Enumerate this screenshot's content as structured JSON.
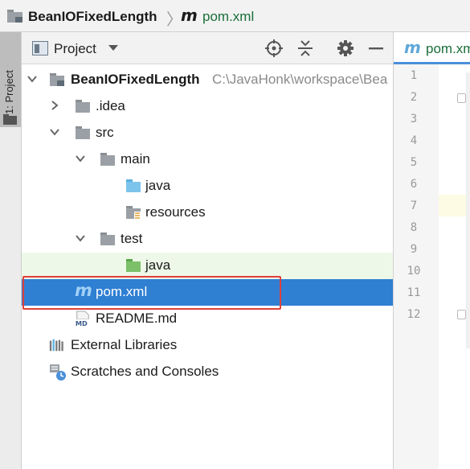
{
  "breadcrumb": {
    "project": "BeanIOFixedLength",
    "file": "pom.xml",
    "maven_glyph": "m"
  },
  "sidebar": {
    "tab_label": "1: Project"
  },
  "panel": {
    "title": "Project"
  },
  "tree": {
    "root": {
      "name": "BeanIOFixedLength",
      "path": "C:\\JavaHonk\\workspace\\Bea"
    },
    "idea": ".idea",
    "src": "src",
    "main": "main",
    "main_java": "java",
    "resources": "resources",
    "test": "test",
    "test_java": "java",
    "pom": "pom.xml",
    "readme": "README.md",
    "readme_badge": "MD",
    "external_libraries": "External Libraries",
    "scratches": "Scratches and Consoles"
  },
  "editor": {
    "tab_label": "pom.xm",
    "line_numbers": [
      "1",
      "2",
      "3",
      "4",
      "5",
      "6",
      "7",
      "8",
      "9",
      "10",
      "11",
      "12"
    ],
    "current_line": 7
  },
  "colors": {
    "selection": "#2f7fd3",
    "highlight_row": "#eef8e8",
    "annotation": "#e0403a",
    "maven": "#5fa8d8"
  }
}
